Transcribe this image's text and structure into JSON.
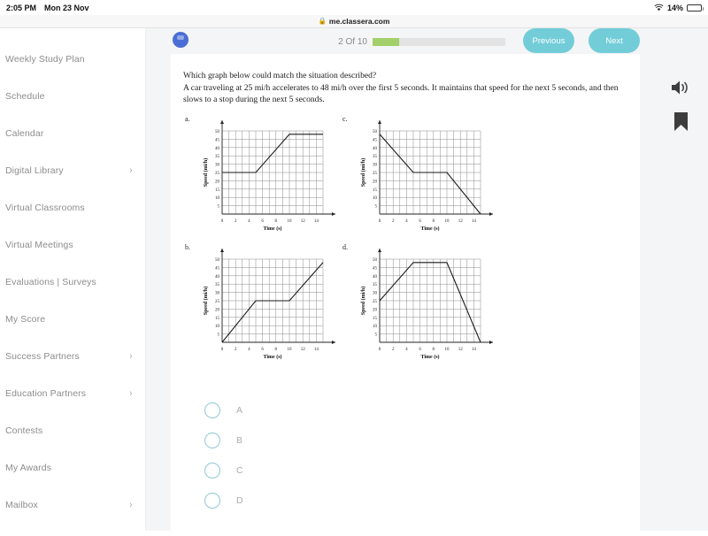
{
  "status_bar": {
    "time": "2:05 PM",
    "date": "Mon 23 Nov",
    "battery_percent": "14%",
    "wifi_icon": "wifi-icon",
    "battery_icon": "battery-icon"
  },
  "browser": {
    "url": "me.classera.com",
    "lock_icon": "lock-icon"
  },
  "sidebar": {
    "items": [
      {
        "label": "Weekly Study Plan",
        "has_chevron": false
      },
      {
        "label": "Schedule",
        "has_chevron": false
      },
      {
        "label": "Calendar",
        "has_chevron": false
      },
      {
        "label": "Digital Library",
        "has_chevron": true
      },
      {
        "label": "Virtual Classrooms",
        "has_chevron": false
      },
      {
        "label": "Virtual Meetings",
        "has_chevron": false
      },
      {
        "label": "Evaluations | Surveys",
        "has_chevron": false
      },
      {
        "label": "My Score",
        "has_chevron": false
      },
      {
        "label": "Success Partners",
        "has_chevron": true
      },
      {
        "label": "Education Partners",
        "has_chevron": true
      },
      {
        "label": "Contests",
        "has_chevron": false
      },
      {
        "label": "My Awards",
        "has_chevron": false
      },
      {
        "label": "Mailbox",
        "has_chevron": true
      }
    ],
    "chevron_glyph": "›"
  },
  "quiz_bar": {
    "counter": "2 Of 10",
    "progress_percent": 20,
    "previous_label": "Previous",
    "next_label": "Next",
    "progress_color": "#a3d06a",
    "button_color": "#72cdd8",
    "avatar_icon": "avatar-icon"
  },
  "question": {
    "prompt": "Which graph below could match the situation described?",
    "body": "A car traveling at 25 mi/h accelerates to 48 mi/h over the first 5 seconds. It maintains that speed for the next 5 seconds, and then slows to a stop during the next 5 seconds."
  },
  "side_icons": {
    "speaker": "speaker-icon",
    "bookmark": "bookmark-icon"
  },
  "options": [
    {
      "label": "A",
      "selected": false
    },
    {
      "label": "B",
      "selected": false
    },
    {
      "label": "C",
      "selected": false
    },
    {
      "label": "D",
      "selected": false
    }
  ],
  "chart_data": [
    {
      "id": "a",
      "letter": "a.",
      "type": "line",
      "title": "",
      "xlabel": "Time (s)",
      "ylabel": "Speed (mi/h)",
      "xlim": [
        0,
        15
      ],
      "ylim": [
        0,
        50
      ],
      "xticks": [
        0,
        2,
        4,
        6,
        8,
        10,
        12,
        14
      ],
      "yticks": [
        5,
        10,
        15,
        20,
        25,
        30,
        35,
        40,
        45,
        50
      ],
      "grid": true,
      "x": [
        0,
        5,
        10,
        15
      ],
      "y": [
        25,
        25,
        48,
        48
      ]
    },
    {
      "id": "c",
      "letter": "c.",
      "type": "line",
      "title": "",
      "xlabel": "Time (s)",
      "ylabel": "Speed (mi/h)",
      "xlim": [
        0,
        15
      ],
      "ylim": [
        0,
        50
      ],
      "xticks": [
        0,
        2,
        4,
        6,
        8,
        10,
        12,
        14
      ],
      "yticks": [
        5,
        10,
        15,
        20,
        25,
        30,
        35,
        40,
        45,
        50
      ],
      "grid": true,
      "x": [
        0,
        5,
        10,
        15
      ],
      "y": [
        48,
        25,
        25,
        0
      ]
    },
    {
      "id": "b",
      "letter": "b.",
      "type": "line",
      "title": "",
      "xlabel": "Time (s)",
      "ylabel": "Speed (mi/h)",
      "xlim": [
        0,
        15
      ],
      "ylim": [
        0,
        50
      ],
      "xticks": [
        0,
        2,
        4,
        6,
        8,
        10,
        12,
        14
      ],
      "yticks": [
        5,
        10,
        15,
        20,
        25,
        30,
        35,
        40,
        45,
        50
      ],
      "grid": true,
      "x": [
        0,
        5,
        10,
        15
      ],
      "y": [
        0,
        25,
        25,
        48
      ]
    },
    {
      "id": "d",
      "letter": "d.",
      "type": "line",
      "title": "",
      "xlabel": "Time (s)",
      "ylabel": "Speed (mi/h)",
      "xlim": [
        0,
        15
      ],
      "ylim": [
        0,
        50
      ],
      "xticks": [
        0,
        2,
        4,
        6,
        8,
        10,
        12,
        14
      ],
      "yticks": [
        5,
        10,
        15,
        20,
        25,
        30,
        35,
        40,
        45,
        50
      ],
      "grid": true,
      "x": [
        0,
        5,
        10,
        15
      ],
      "y": [
        25,
        48,
        48,
        0
      ]
    }
  ]
}
